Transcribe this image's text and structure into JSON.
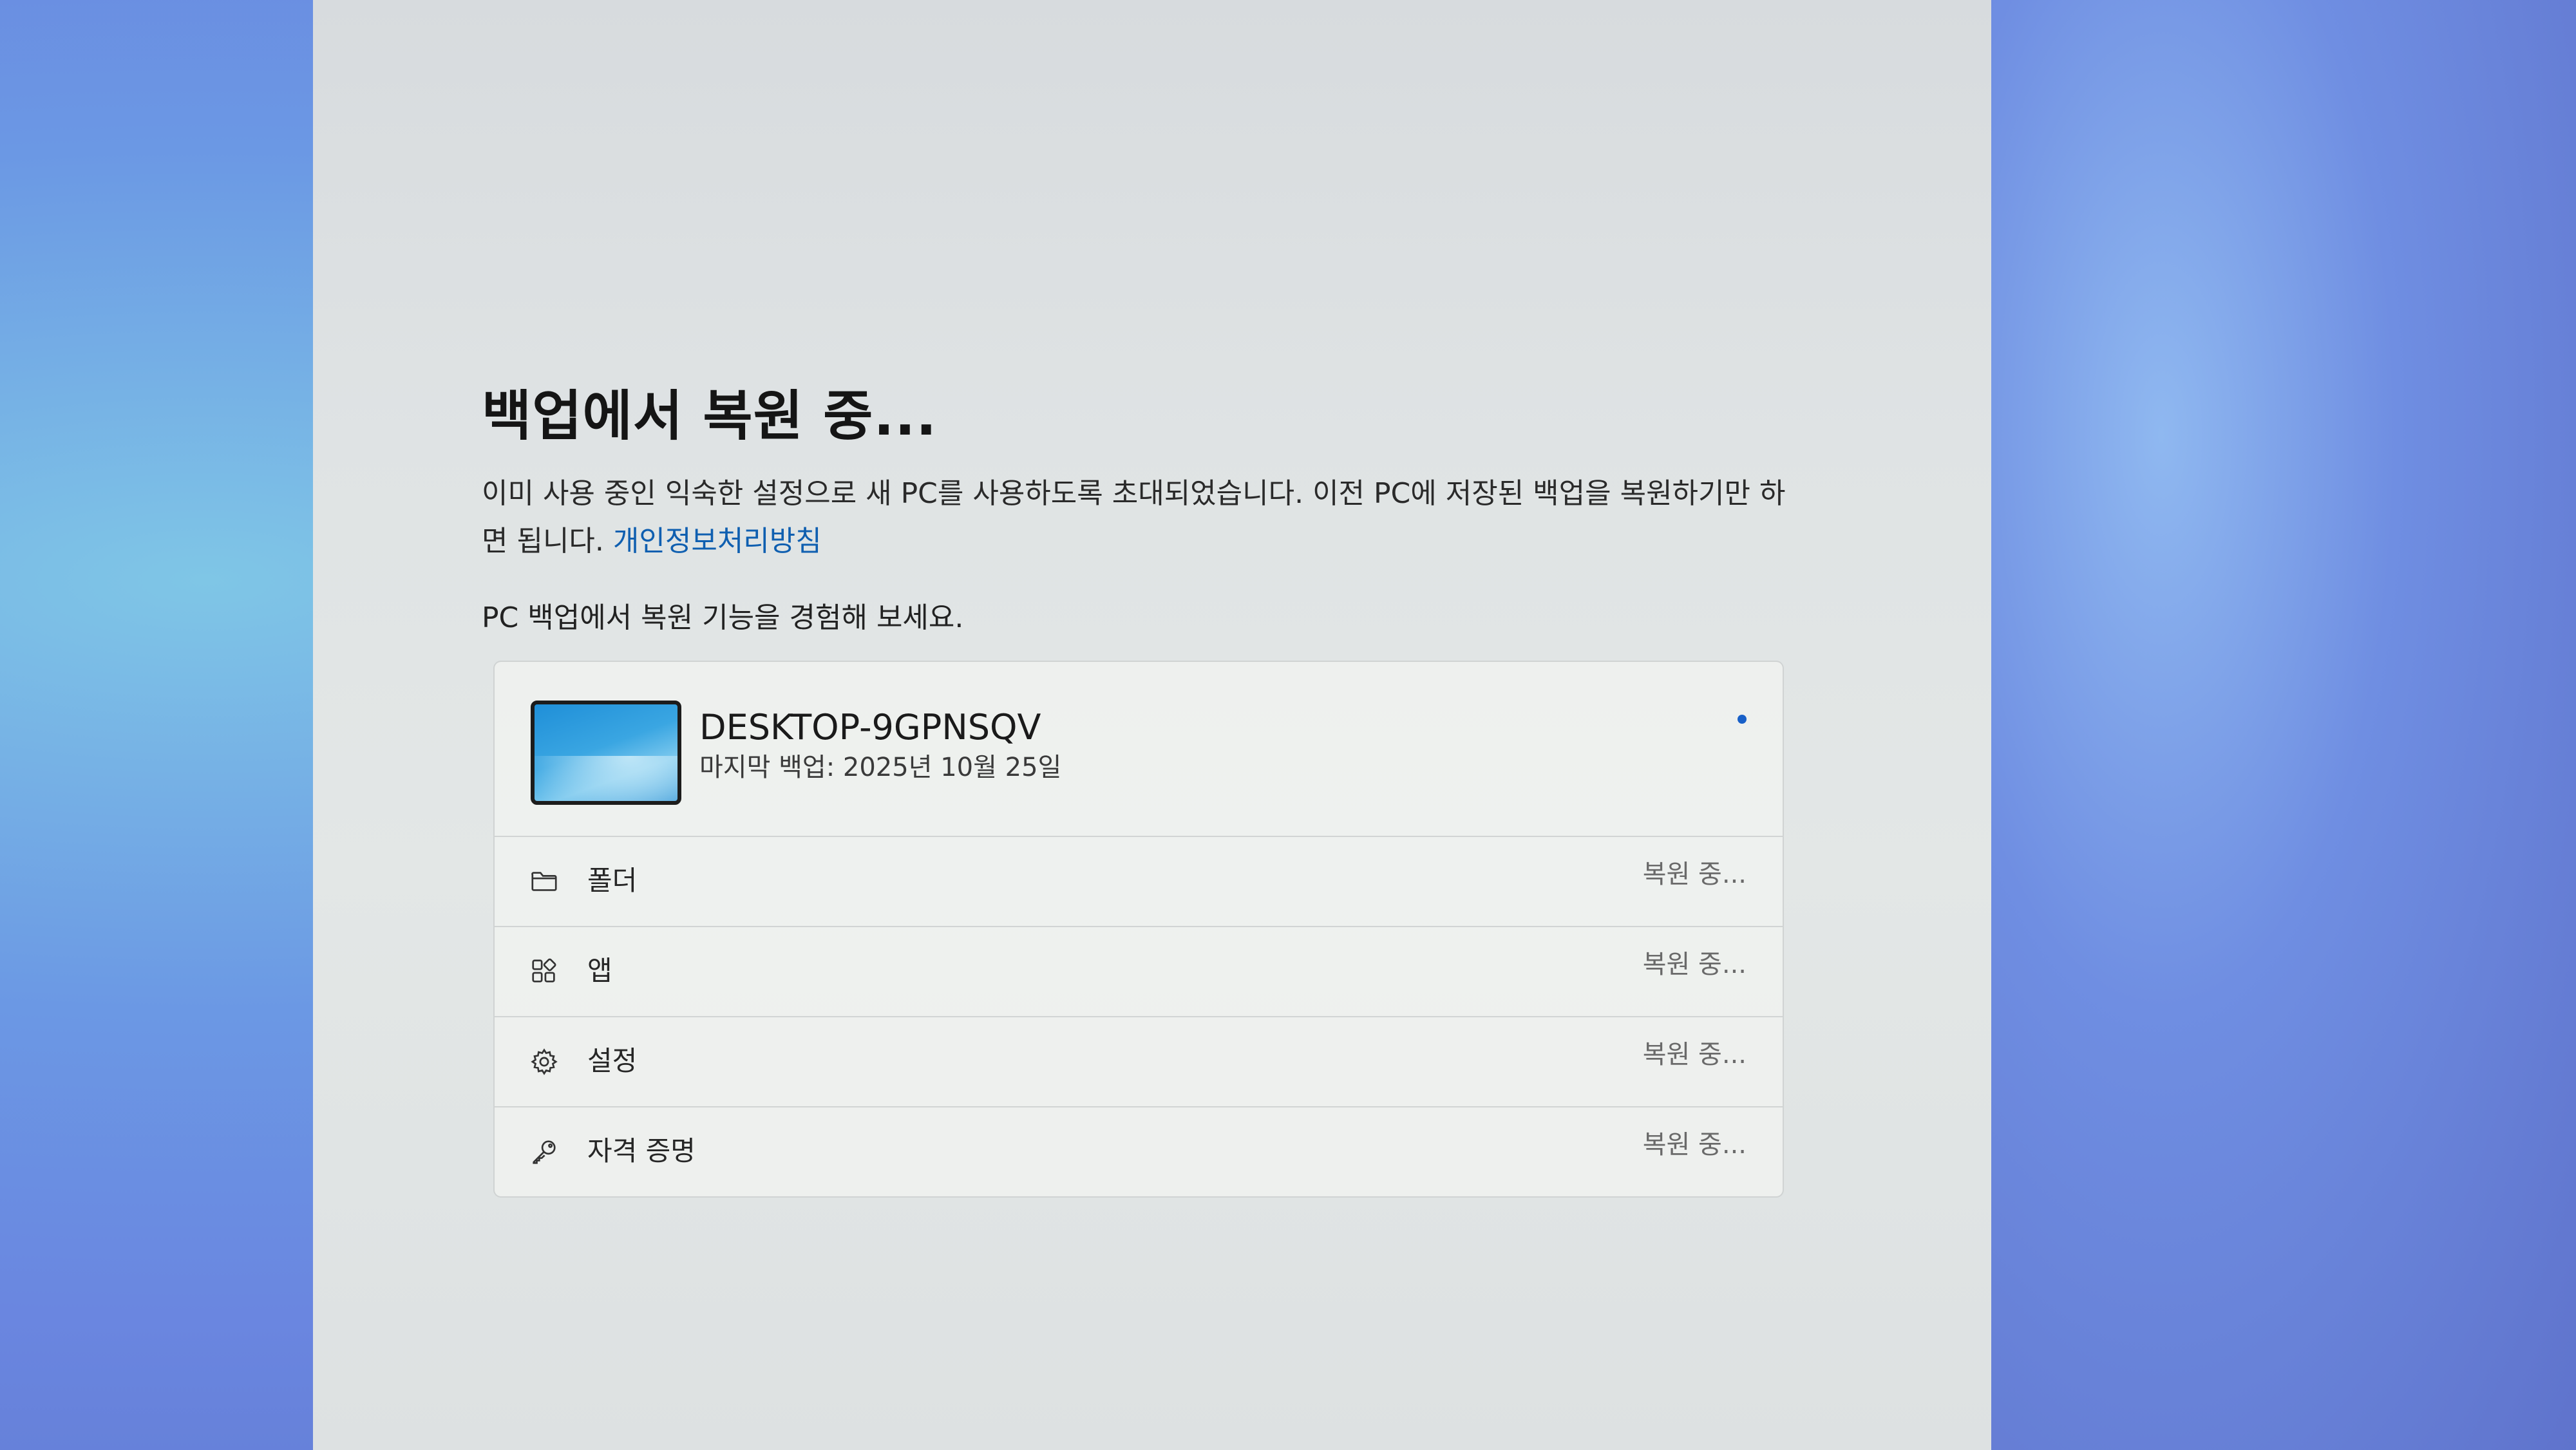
{
  "page": {
    "title": "백업에서 복원 중...",
    "description": "이미 사용 중인 익숙한 설정으로 새 PC를 사용하도록 초대되었습니다. 이전 PC에 저장된 백업을 복원하기만 하면 됩니다.",
    "privacy_link": "개인정보처리방침",
    "subdescription": "PC 백업에서 복원 기능을 경험해 보세요."
  },
  "device": {
    "name": "DESKTOP-9GPNSQV",
    "last_backup": "마지막 백업: 2025년 10월 25일"
  },
  "items": [
    {
      "label": "폴더",
      "status": "복원 중...",
      "icon": "folder-icon"
    },
    {
      "label": "앱",
      "status": "복원 중...",
      "icon": "apps-icon"
    },
    {
      "label": "설정",
      "status": "복원 중...",
      "icon": "gear-icon"
    },
    {
      "label": "자격 증명",
      "status": "복원 중...",
      "icon": "key-icon"
    }
  ],
  "colors": {
    "link": "#0f5fb0",
    "spinner": "#1860c8"
  }
}
